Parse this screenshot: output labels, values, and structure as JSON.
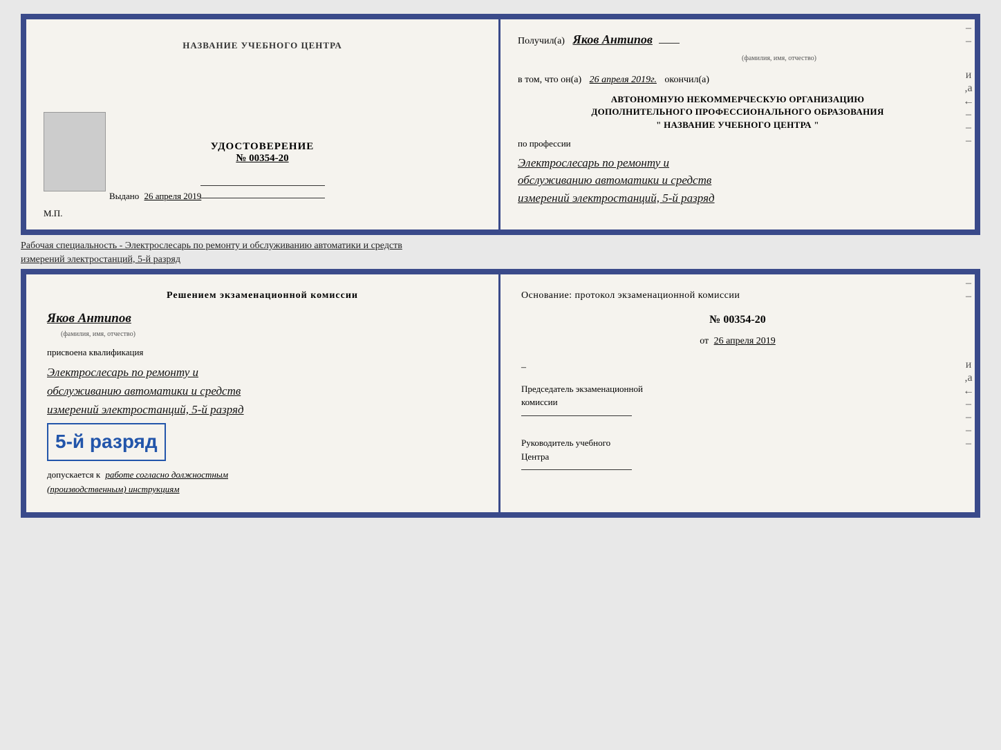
{
  "page": {
    "background_color": "#e8e8e8"
  },
  "top_doc": {
    "left": {
      "school_name": "НАЗВАНИЕ УЧЕБНОГО ЦЕНТРА",
      "udostoverenie_label": "УДОСТОВЕРЕНИЕ",
      "number": "№ 00354-20",
      "vydano_label": "Выдано",
      "vydano_date": "26 апреля 2019",
      "mp_label": "М.П."
    },
    "right": {
      "recipient_prefix": "Получил(а)",
      "recipient_name": "Яков Антипов",
      "recipient_subtext": "(фамилия, имя, отчество)",
      "date_prefix": "в том, что он(а)",
      "date_value": "26 апреля 2019г.",
      "date_suffix": "окончил(а)",
      "org_line1": "АВТОНОМНУЮ НЕКОММЕРЧЕСКУЮ ОРГАНИЗАЦИЮ",
      "org_line2": "ДОПОЛНИТЕЛЬНОГО ПРОФЕССИОНАЛЬНОГО ОБРАЗОВАНИЯ",
      "org_line3": "\" НАЗВАНИЕ УЧЕБНОГО ЦЕНТРА \"",
      "profession_label": "по профессии",
      "profession_line1": "Электрослесарь по ремонту и",
      "profession_line2": "обслуживанию автоматики и средств",
      "profession_line3": "измерений электростанций, 5-й разряд"
    }
  },
  "middle_text": {
    "line1": "Рабочая специальность - Электрослесарь по ремонту и обслуживанию автоматики и средств",
    "line2": "измерений электростанций, 5-й разряд"
  },
  "bottom_doc": {
    "left": {
      "decision_label": "Решением экзаменационной комиссии",
      "person_name": "Яков Антипов",
      "person_subtext": "(фамилия, имя, отчество)",
      "assigned_label": "присвоена квалификация",
      "qualification_line1": "Электрослесарь по ремонту и",
      "qualification_line2": "обслуживанию автоматики и средств",
      "qualification_line3": "измерений электростанций, 5-й разряд",
      "razryad_big": "5-й разряд",
      "dopusk_prefix": "допускается к",
      "dopusk_text": "работе согласно должностным",
      "dopusk_text2": "(производственным) инструкциям"
    },
    "right": {
      "osnov_label": "Основание: протокол экзаменационной комиссии",
      "protocol_num": "№ 00354-20",
      "protocol_date_prefix": "от",
      "protocol_date": "26 апреля 2019",
      "chairman_label": "Председатель экзаменационной",
      "chairman_label2": "комиссии",
      "head_label": "Руководитель учебного",
      "head_label2": "Центра"
    }
  },
  "icons": {
    "dash": "–"
  }
}
